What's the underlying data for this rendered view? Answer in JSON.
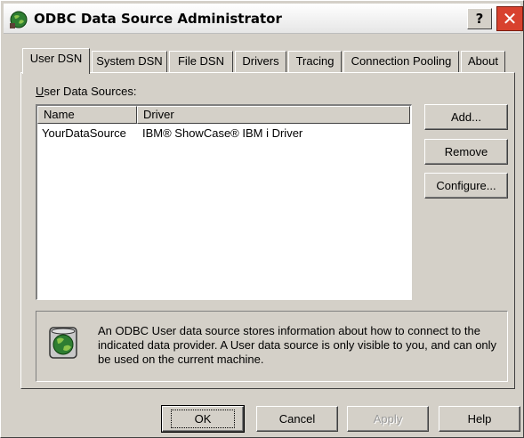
{
  "window": {
    "title": "ODBC Data Source Administrator",
    "help_label": "?",
    "close_label": "✕"
  },
  "tabs": [
    {
      "label": "User DSN",
      "active": true
    },
    {
      "label": "System DSN",
      "active": false
    },
    {
      "label": "File DSN",
      "active": false
    },
    {
      "label": "Drivers",
      "active": false
    },
    {
      "label": "Tracing",
      "active": false
    },
    {
      "label": "Connection Pooling",
      "active": false
    },
    {
      "label": "About",
      "active": false
    }
  ],
  "user_dsn": {
    "list_label_mnemonic": "U",
    "list_label_rest": "ser Data Sources:",
    "columns": [
      "Name",
      "Driver"
    ],
    "rows": [
      {
        "name": "YourDataSource",
        "driver": "IBM® ShowCase® IBM i Driver"
      }
    ],
    "add_label": "Add...",
    "remove_label": "Remove",
    "configure_label": "Configure...",
    "info_text": "An ODBC User data source stores information about how to connect to the indicated data provider.  A User data source is only visible to you, and can only be used on the current machine."
  },
  "footer": {
    "ok_label": "OK",
    "cancel_label": "Cancel",
    "apply_label": "Apply",
    "help_label": "Help"
  },
  "icons": {
    "title_icon": "odbc-globe-icon",
    "info_icon": "odbc-database-globe-icon"
  }
}
